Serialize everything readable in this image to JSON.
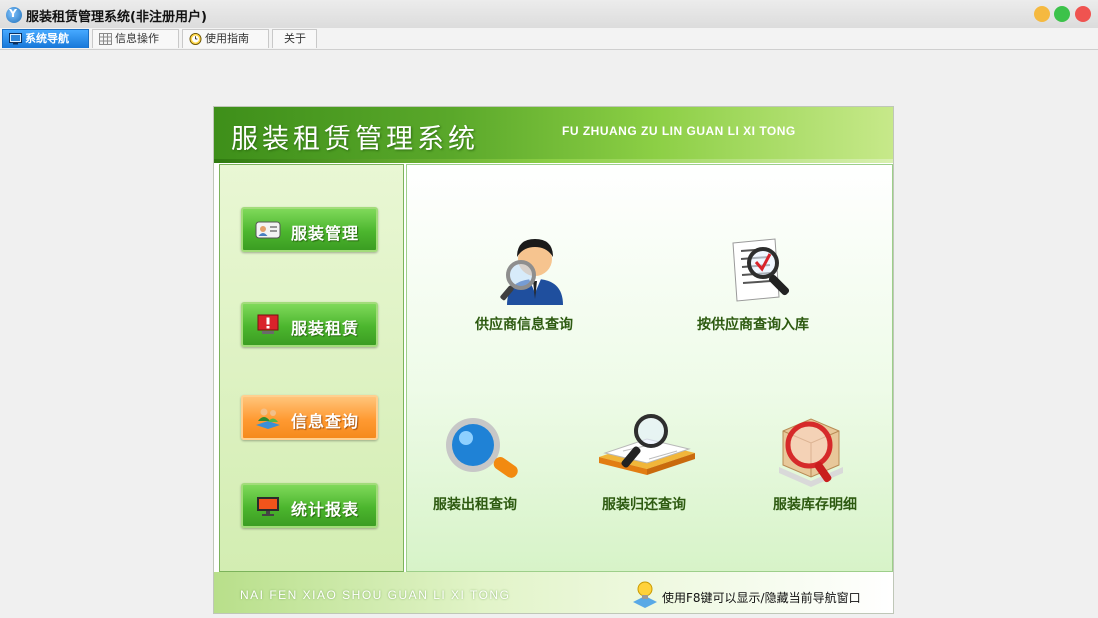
{
  "window": {
    "title": "服装租赁管理系统(非注册用户)"
  },
  "tabs": [
    {
      "label": "系统导航",
      "icon": "monitor-icon",
      "active": true
    },
    {
      "label": "信息操作",
      "icon": "grid-icon",
      "active": false
    },
    {
      "label": "使用指南",
      "icon": "clock-icon",
      "active": false
    },
    {
      "label": "关于",
      "icon": "",
      "active": false
    }
  ],
  "banner": {
    "title": "服装租赁管理系统",
    "subtitle": "FU ZHUANG ZU LIN GUAN LI XI TONG"
  },
  "sidebar": {
    "items": [
      {
        "label": "服装管理",
        "icon": "id-card-icon",
        "active": false
      },
      {
        "label": "服装租赁",
        "icon": "alert-monitor-icon",
        "active": false
      },
      {
        "label": "信息查询",
        "icon": "people-icon",
        "active": true
      },
      {
        "label": "统计报表",
        "icon": "monitor-icon",
        "active": false
      }
    ]
  },
  "functions": [
    {
      "label": "供应商信息查询",
      "icon": "person-magnifier-icon"
    },
    {
      "label": "按供应商查询入库",
      "icon": "document-magnifier-icon"
    },
    {
      "label": "服装出租查询",
      "icon": "magnifier-icon"
    },
    {
      "label": "服装归还查询",
      "icon": "book-magnifier-icon"
    },
    {
      "label": "服装库存明细",
      "icon": "box-magnifier-icon"
    }
  ],
  "footer": {
    "subtitle": "NAI FEN XIAO SHOU GUAN LI XI TONG",
    "hint": "使用F8键可以显示/隐藏当前导航窗口"
  },
  "colors": {
    "banner_green": "#4fa324",
    "active_tab": "#1e82e3",
    "active_nav": "#ff9a32",
    "nav_green": "#4cb62e",
    "label_green": "#2d5a10"
  }
}
